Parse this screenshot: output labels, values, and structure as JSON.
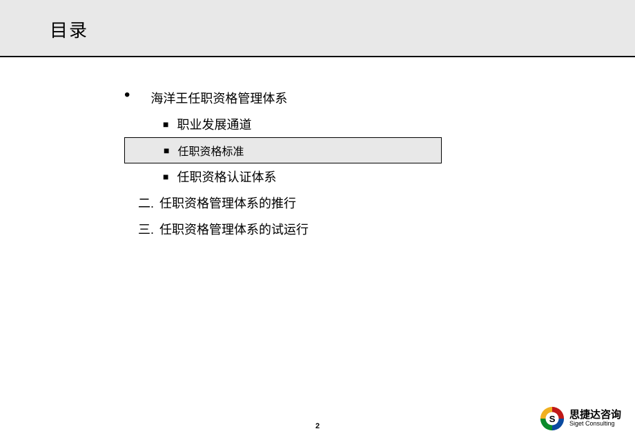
{
  "header": {
    "title": "目录"
  },
  "toc": {
    "item1": {
      "label": "海洋王任职资格管理体系",
      "sub1": "职业发展通道",
      "sub2": "任职资格标准",
      "sub3": "任职资格认证体系"
    },
    "item2": {
      "num": "二.",
      "label": "任职资格管理体系的推行"
    },
    "item3": {
      "num": "三.",
      "label": "任职资格管理体系的试运行"
    }
  },
  "footer": {
    "page_number": "2",
    "logo_cn": "思捷达咨询",
    "logo_en": "Siget Consulting"
  }
}
